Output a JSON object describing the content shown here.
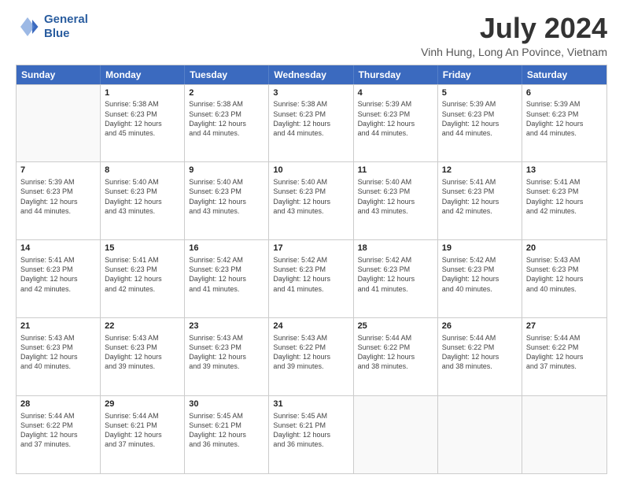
{
  "logo": {
    "line1": "General",
    "line2": "Blue"
  },
  "header": {
    "month_year": "July 2024",
    "location": "Vinh Hung, Long An Povince, Vietnam"
  },
  "days_of_week": [
    "Sunday",
    "Monday",
    "Tuesday",
    "Wednesday",
    "Thursday",
    "Friday",
    "Saturday"
  ],
  "weeks": [
    [
      {
        "day": "",
        "info": ""
      },
      {
        "day": "1",
        "info": "Sunrise: 5:38 AM\nSunset: 6:23 PM\nDaylight: 12 hours\nand 45 minutes."
      },
      {
        "day": "2",
        "info": "Sunrise: 5:38 AM\nSunset: 6:23 PM\nDaylight: 12 hours\nand 44 minutes."
      },
      {
        "day": "3",
        "info": "Sunrise: 5:38 AM\nSunset: 6:23 PM\nDaylight: 12 hours\nand 44 minutes."
      },
      {
        "day": "4",
        "info": "Sunrise: 5:39 AM\nSunset: 6:23 PM\nDaylight: 12 hours\nand 44 minutes."
      },
      {
        "day": "5",
        "info": "Sunrise: 5:39 AM\nSunset: 6:23 PM\nDaylight: 12 hours\nand 44 minutes."
      },
      {
        "day": "6",
        "info": "Sunrise: 5:39 AM\nSunset: 6:23 PM\nDaylight: 12 hours\nand 44 minutes."
      }
    ],
    [
      {
        "day": "7",
        "info": "Sunrise: 5:39 AM\nSunset: 6:23 PM\nDaylight: 12 hours\nand 44 minutes."
      },
      {
        "day": "8",
        "info": "Sunrise: 5:40 AM\nSunset: 6:23 PM\nDaylight: 12 hours\nand 43 minutes."
      },
      {
        "day": "9",
        "info": "Sunrise: 5:40 AM\nSunset: 6:23 PM\nDaylight: 12 hours\nand 43 minutes."
      },
      {
        "day": "10",
        "info": "Sunrise: 5:40 AM\nSunset: 6:23 PM\nDaylight: 12 hours\nand 43 minutes."
      },
      {
        "day": "11",
        "info": "Sunrise: 5:40 AM\nSunset: 6:23 PM\nDaylight: 12 hours\nand 43 minutes."
      },
      {
        "day": "12",
        "info": "Sunrise: 5:41 AM\nSunset: 6:23 PM\nDaylight: 12 hours\nand 42 minutes."
      },
      {
        "day": "13",
        "info": "Sunrise: 5:41 AM\nSunset: 6:23 PM\nDaylight: 12 hours\nand 42 minutes."
      }
    ],
    [
      {
        "day": "14",
        "info": "Sunrise: 5:41 AM\nSunset: 6:23 PM\nDaylight: 12 hours\nand 42 minutes."
      },
      {
        "day": "15",
        "info": "Sunrise: 5:41 AM\nSunset: 6:23 PM\nDaylight: 12 hours\nand 42 minutes."
      },
      {
        "day": "16",
        "info": "Sunrise: 5:42 AM\nSunset: 6:23 PM\nDaylight: 12 hours\nand 41 minutes."
      },
      {
        "day": "17",
        "info": "Sunrise: 5:42 AM\nSunset: 6:23 PM\nDaylight: 12 hours\nand 41 minutes."
      },
      {
        "day": "18",
        "info": "Sunrise: 5:42 AM\nSunset: 6:23 PM\nDaylight: 12 hours\nand 41 minutes."
      },
      {
        "day": "19",
        "info": "Sunrise: 5:42 AM\nSunset: 6:23 PM\nDaylight: 12 hours\nand 40 minutes."
      },
      {
        "day": "20",
        "info": "Sunrise: 5:43 AM\nSunset: 6:23 PM\nDaylight: 12 hours\nand 40 minutes."
      }
    ],
    [
      {
        "day": "21",
        "info": "Sunrise: 5:43 AM\nSunset: 6:23 PM\nDaylight: 12 hours\nand 40 minutes."
      },
      {
        "day": "22",
        "info": "Sunrise: 5:43 AM\nSunset: 6:23 PM\nDaylight: 12 hours\nand 39 minutes."
      },
      {
        "day": "23",
        "info": "Sunrise: 5:43 AM\nSunset: 6:23 PM\nDaylight: 12 hours\nand 39 minutes."
      },
      {
        "day": "24",
        "info": "Sunrise: 5:43 AM\nSunset: 6:22 PM\nDaylight: 12 hours\nand 39 minutes."
      },
      {
        "day": "25",
        "info": "Sunrise: 5:44 AM\nSunset: 6:22 PM\nDaylight: 12 hours\nand 38 minutes."
      },
      {
        "day": "26",
        "info": "Sunrise: 5:44 AM\nSunset: 6:22 PM\nDaylight: 12 hours\nand 38 minutes."
      },
      {
        "day": "27",
        "info": "Sunrise: 5:44 AM\nSunset: 6:22 PM\nDaylight: 12 hours\nand 37 minutes."
      }
    ],
    [
      {
        "day": "28",
        "info": "Sunrise: 5:44 AM\nSunset: 6:22 PM\nDaylight: 12 hours\nand 37 minutes."
      },
      {
        "day": "29",
        "info": "Sunrise: 5:44 AM\nSunset: 6:21 PM\nDaylight: 12 hours\nand 37 minutes."
      },
      {
        "day": "30",
        "info": "Sunrise: 5:45 AM\nSunset: 6:21 PM\nDaylight: 12 hours\nand 36 minutes."
      },
      {
        "day": "31",
        "info": "Sunrise: 5:45 AM\nSunset: 6:21 PM\nDaylight: 12 hours\nand 36 minutes."
      },
      {
        "day": "",
        "info": ""
      },
      {
        "day": "",
        "info": ""
      },
      {
        "day": "",
        "info": ""
      }
    ]
  ]
}
